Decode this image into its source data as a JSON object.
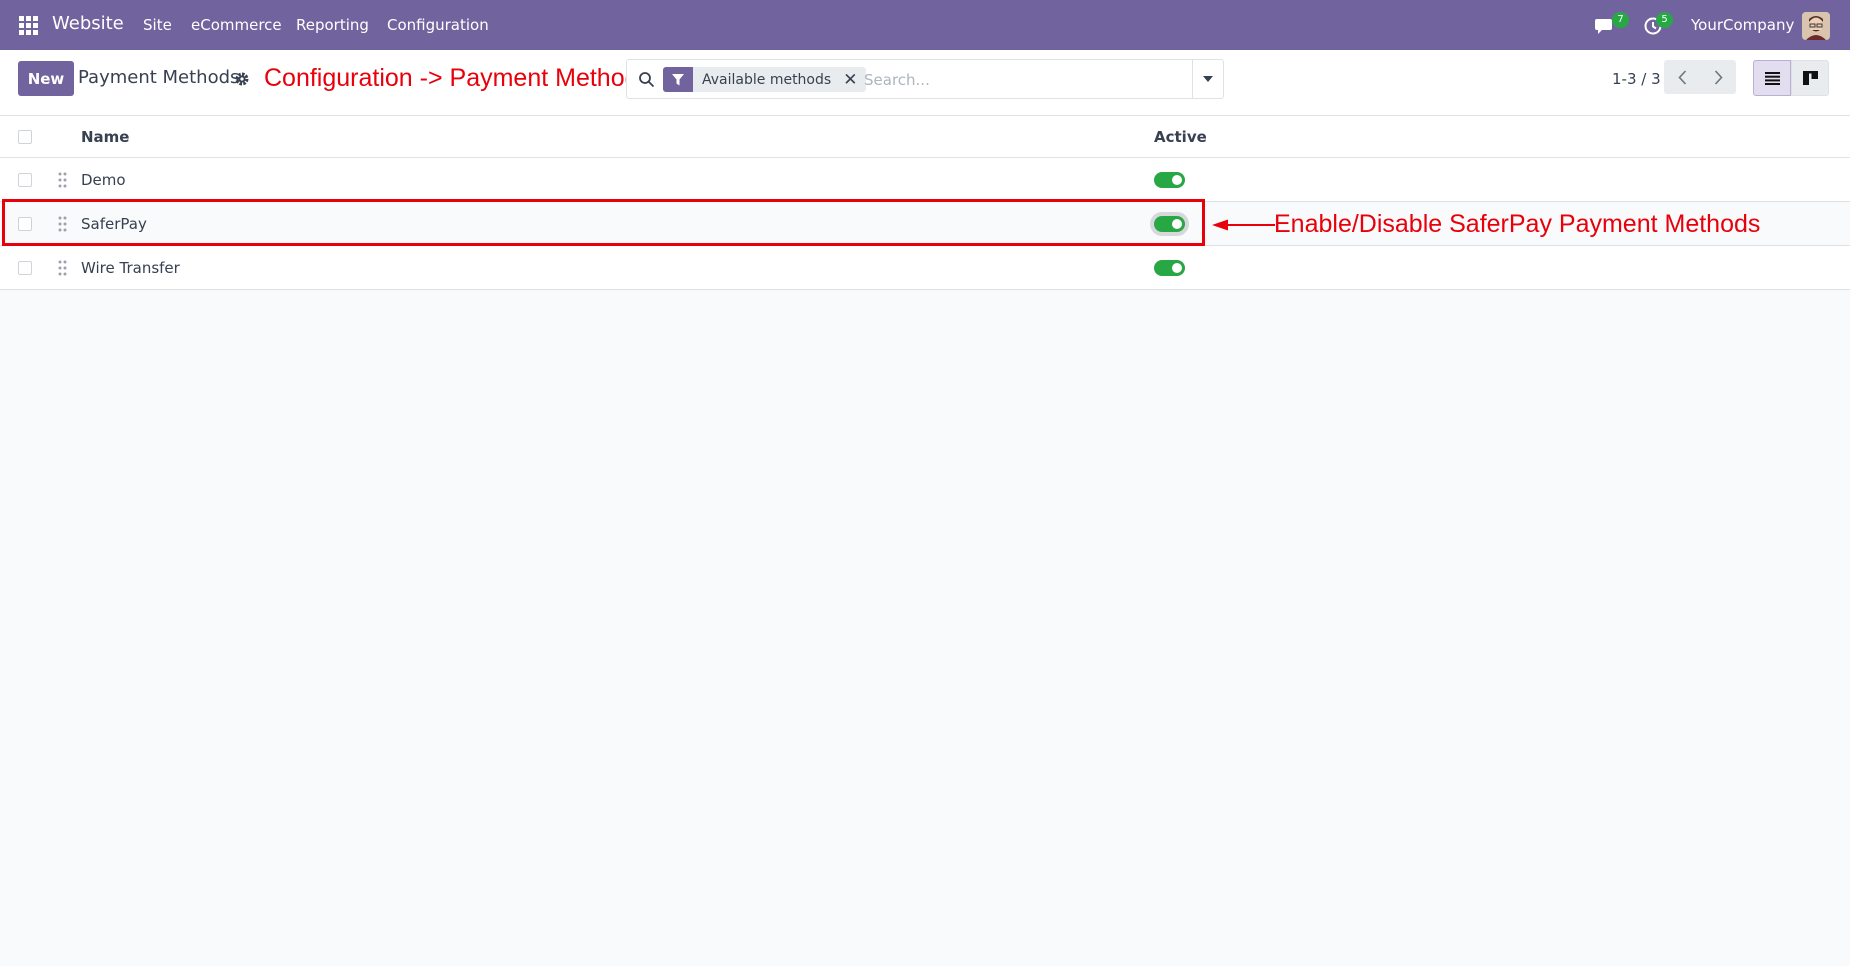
{
  "navbar": {
    "brand": "Website",
    "menu": [
      "Site",
      "eCommerce",
      "Reporting",
      "Configuration"
    ],
    "messages_count": "7",
    "activities_count": "5",
    "company": "YourCompany"
  },
  "control_panel": {
    "new_label": "New",
    "title": "Payment Methods",
    "search": {
      "facet_label": "Available methods",
      "placeholder": "Search..."
    },
    "pager": "1-3 / 3"
  },
  "list": {
    "columns": {
      "name": "Name",
      "active": "Active"
    },
    "rows": [
      {
        "name": "Demo",
        "active": true
      },
      {
        "name": "SaferPay",
        "active": true
      },
      {
        "name": "Wire Transfer",
        "active": true
      }
    ]
  },
  "annotations": {
    "top": "Configuration -> Payment Methods",
    "side": "Enable/Disable SaferPay Payment Methods"
  },
  "colors": {
    "brand": "#71639e",
    "toggle_on": "#28a745",
    "annotation": "#e8000b",
    "badge": "#28a745"
  }
}
